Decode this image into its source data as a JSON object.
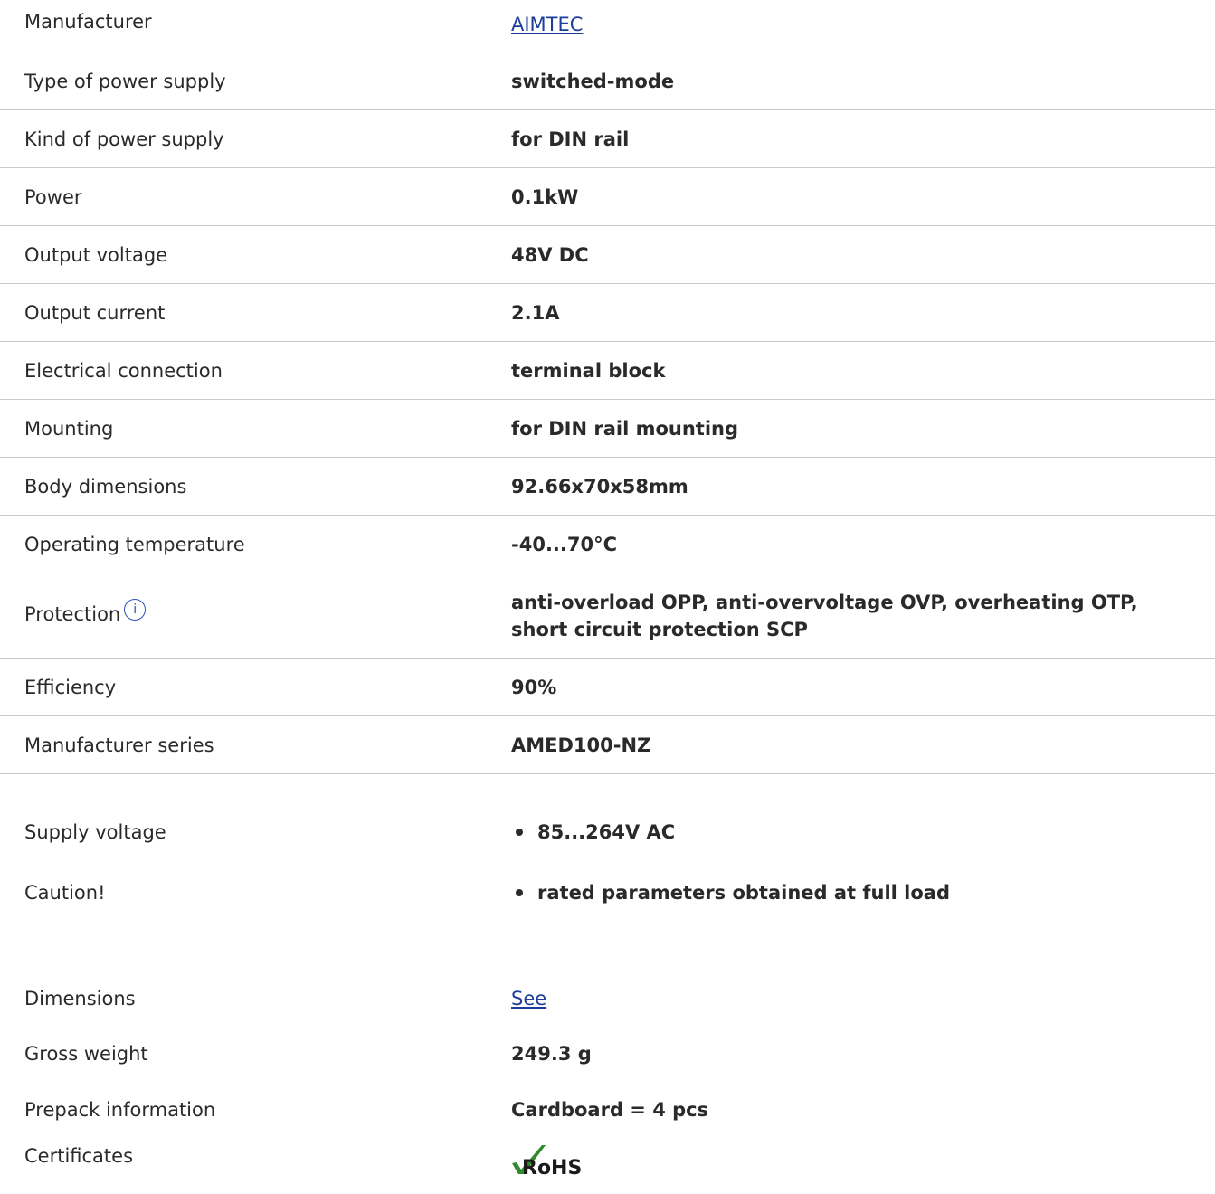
{
  "specs": [
    {
      "label": "Manufacturer",
      "value": "AIMTEC",
      "link": true
    },
    {
      "label": "Type of power supply",
      "value": "switched-mode"
    },
    {
      "label": "Kind of power supply",
      "value": "for DIN rail"
    },
    {
      "label": "Power",
      "value": "0.1kW"
    },
    {
      "label": "Output voltage",
      "value": "48V DC"
    },
    {
      "label": "Output current",
      "value": "2.1A"
    },
    {
      "label": "Electrical connection",
      "value": "terminal block"
    },
    {
      "label": "Mounting",
      "value": "for DIN rail mounting"
    },
    {
      "label": "Body dimensions",
      "value": "92.66x70x58mm"
    },
    {
      "label": "Operating temperature",
      "value": "-40...70°C"
    },
    {
      "label": "Protection",
      "value": "anti-overload OPP, anti-overvoltage OVP, overheating OTP, short circuit protection SCP",
      "info_icon": "i"
    },
    {
      "label": "Efficiency",
      "value": "90%"
    },
    {
      "label": "Manufacturer series",
      "value": "AMED100-NZ"
    }
  ],
  "extra": {
    "supply_voltage": {
      "label": "Supply voltage",
      "value": "85...264V AC"
    },
    "caution": {
      "label": "Caution!",
      "value": "rated parameters obtained at full load"
    },
    "dimensions": {
      "label": "Dimensions",
      "value": "See"
    },
    "gross_weight": {
      "label": "Gross weight",
      "value": "249.3 g"
    },
    "prepack": {
      "label": "Prepack information",
      "value": "Cardboard = 4 pcs"
    },
    "certificates": {
      "label": "Certificates",
      "badge": "RoHS"
    }
  },
  "colors": {
    "link": "#1d3d9a",
    "info_icon": "#2f4fbf",
    "divider": "#c9c9c9",
    "rohs_check": "#2e8b2e"
  },
  "icons": {
    "info": "info-icon",
    "rohs": "rohs-checkmark-icon"
  }
}
